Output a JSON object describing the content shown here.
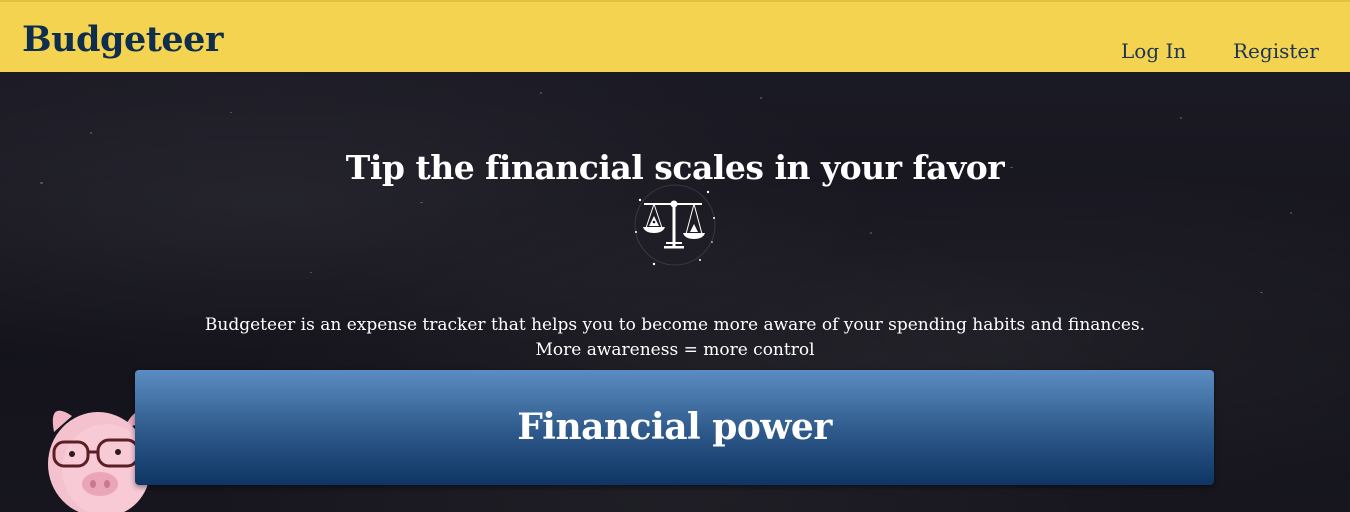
{
  "navbar": {
    "brand": "Budgeteer",
    "links": [
      {
        "label": "Log In"
      },
      {
        "label": "Register"
      }
    ],
    "background_color": "#f3d34f",
    "text_color": "#0f2d4d"
  },
  "hero": {
    "headline": "Tip the financial scales in your favor",
    "icon": "balance-scale-icon",
    "description_lines": [
      "Budgeteer is an expense tracker that helps you to become more aware of your spending habits and finances.",
      "More awareness = more control"
    ],
    "cta_label": "Financial power",
    "cta_gradient": [
      "#5b8dc2",
      "#0e3564"
    ],
    "mascot": "piggy-bank-with-glasses"
  }
}
